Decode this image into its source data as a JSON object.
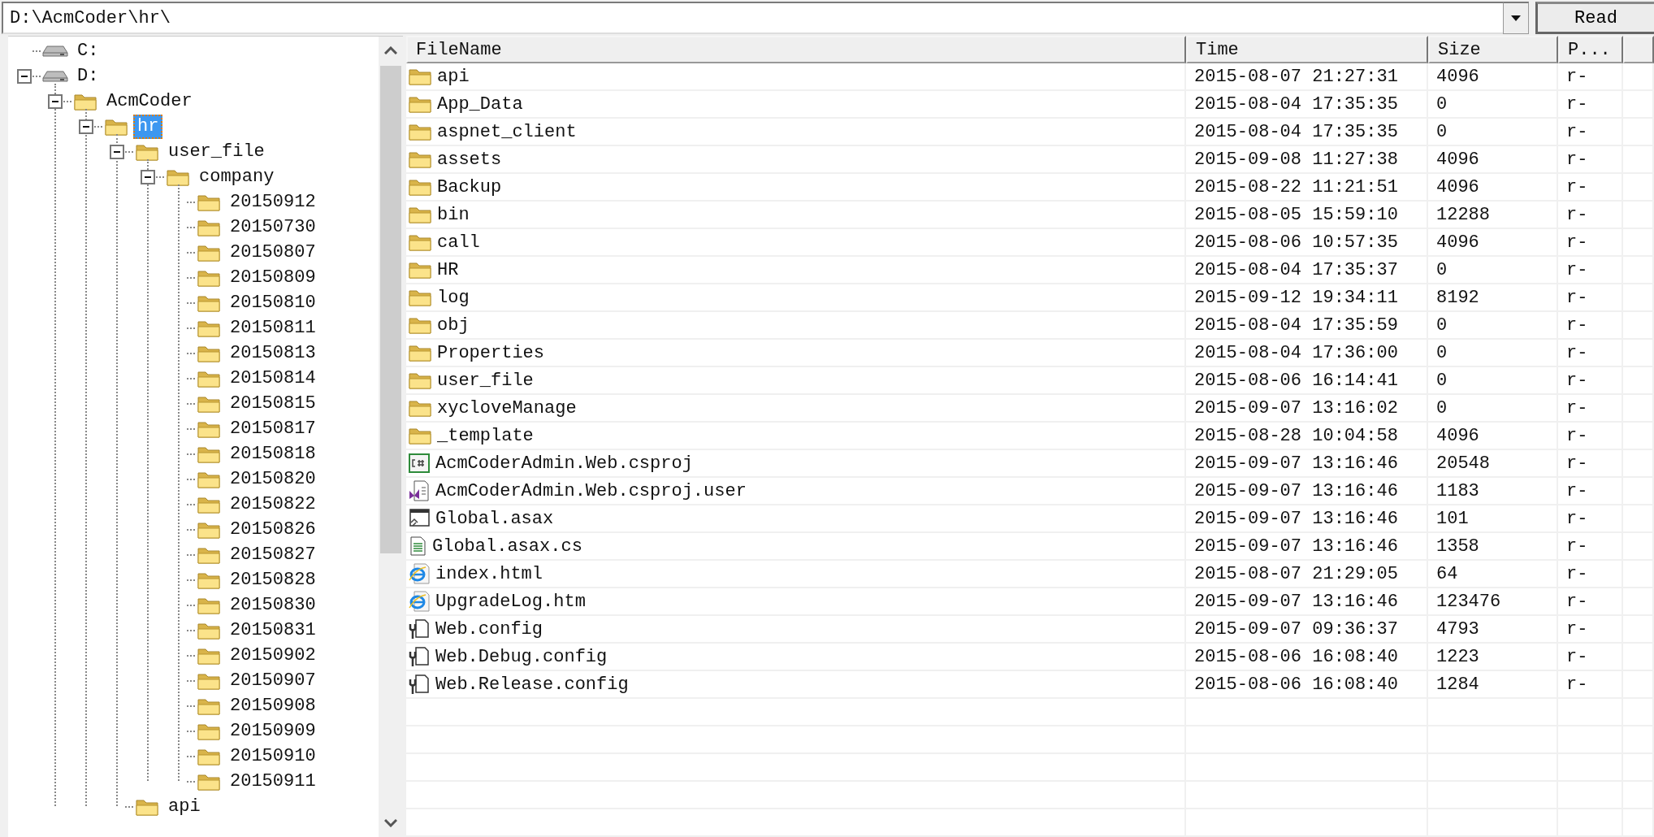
{
  "path_field": {
    "value": "D:\\AcmCoder\\hr\\"
  },
  "read_button": "Read",
  "tree": [
    {
      "label": "C:",
      "kind": "drive",
      "selected": false
    },
    {
      "label": "D:",
      "kind": "drive",
      "selected": false,
      "expanded": true,
      "children": [
        {
          "label": "AcmCoder",
          "kind": "folder",
          "selected": false,
          "expanded": true,
          "children": [
            {
              "label": "hr",
              "kind": "folder",
              "selected": true,
              "expanded": true,
              "children": [
                {
                  "label": "user_file",
                  "kind": "folder",
                  "selected": false,
                  "expanded": true,
                  "children": [
                    {
                      "label": "company",
                      "kind": "folder",
                      "selected": false,
                      "expanded": true,
                      "children": [
                        {
                          "label": "20150912",
                          "kind": "folder",
                          "selected": false
                        },
                        {
                          "label": "20150730",
                          "kind": "folder",
                          "selected": false
                        },
                        {
                          "label": "20150807",
                          "kind": "folder",
                          "selected": false
                        },
                        {
                          "label": "20150809",
                          "kind": "folder",
                          "selected": false
                        },
                        {
                          "label": "20150810",
                          "kind": "folder",
                          "selected": false
                        },
                        {
                          "label": "20150811",
                          "kind": "folder",
                          "selected": false
                        },
                        {
                          "label": "20150813",
                          "kind": "folder",
                          "selected": false
                        },
                        {
                          "label": "20150814",
                          "kind": "folder",
                          "selected": false
                        },
                        {
                          "label": "20150815",
                          "kind": "folder",
                          "selected": false
                        },
                        {
                          "label": "20150817",
                          "kind": "folder",
                          "selected": false
                        },
                        {
                          "label": "20150818",
                          "kind": "folder",
                          "selected": false
                        },
                        {
                          "label": "20150820",
                          "kind": "folder",
                          "selected": false
                        },
                        {
                          "label": "20150822",
                          "kind": "folder",
                          "selected": false
                        },
                        {
                          "label": "20150826",
                          "kind": "folder",
                          "selected": false
                        },
                        {
                          "label": "20150827",
                          "kind": "folder",
                          "selected": false
                        },
                        {
                          "label": "20150828",
                          "kind": "folder",
                          "selected": false
                        },
                        {
                          "label": "20150830",
                          "kind": "folder",
                          "selected": false
                        },
                        {
                          "label": "20150831",
                          "kind": "folder",
                          "selected": false
                        },
                        {
                          "label": "20150902",
                          "kind": "folder",
                          "selected": false
                        },
                        {
                          "label": "20150907",
                          "kind": "folder",
                          "selected": false
                        },
                        {
                          "label": "20150908",
                          "kind": "folder",
                          "selected": false
                        },
                        {
                          "label": "20150909",
                          "kind": "folder",
                          "selected": false
                        },
                        {
                          "label": "20150910",
                          "kind": "folder",
                          "selected": false
                        },
                        {
                          "label": "20150911",
                          "kind": "folder",
                          "selected": false
                        }
                      ]
                    }
                  ]
                },
                {
                  "label": "api",
                  "kind": "folder",
                  "selected": false
                }
              ]
            }
          ]
        }
      ]
    }
  ],
  "file_list": {
    "columns": [
      "FileName",
      "Time",
      "Size",
      "P..."
    ],
    "rows": [
      {
        "kind": "folder",
        "name": "api",
        "time": "2015-08-07 21:27:31",
        "size": "4096",
        "permission": "r-"
      },
      {
        "kind": "folder",
        "name": "App_Data",
        "time": "2015-08-04 17:35:35",
        "size": "0",
        "permission": "r-"
      },
      {
        "kind": "folder",
        "name": "aspnet_client",
        "time": "2015-08-04 17:35:35",
        "size": "0",
        "permission": "r-"
      },
      {
        "kind": "folder",
        "name": "assets",
        "time": "2015-09-08 11:27:38",
        "size": "4096",
        "permission": "r-"
      },
      {
        "kind": "folder",
        "name": "Backup",
        "time": "2015-08-22 11:21:51",
        "size": "4096",
        "permission": "r-"
      },
      {
        "kind": "folder",
        "name": "bin",
        "time": "2015-08-05 15:59:10",
        "size": "12288",
        "permission": "r-"
      },
      {
        "kind": "folder",
        "name": "call",
        "time": "2015-08-06 10:57:35",
        "size": "4096",
        "permission": "r-"
      },
      {
        "kind": "folder",
        "name": "HR",
        "time": "2015-08-04 17:35:37",
        "size": "0",
        "permission": "r-"
      },
      {
        "kind": "folder",
        "name": "log",
        "time": "2015-09-12 19:34:11",
        "size": "8192",
        "permission": "r-"
      },
      {
        "kind": "folder",
        "name": "obj",
        "time": "2015-08-04 17:35:59",
        "size": "0",
        "permission": "r-"
      },
      {
        "kind": "folder",
        "name": "Properties",
        "time": "2015-08-04 17:36:00",
        "size": "0",
        "permission": "r-"
      },
      {
        "kind": "folder",
        "name": "user_file",
        "time": "2015-08-06 16:14:41",
        "size": "0",
        "permission": "r-"
      },
      {
        "kind": "folder",
        "name": "xycloveManage",
        "time": "2015-09-07 13:16:02",
        "size": "0",
        "permission": "r-"
      },
      {
        "kind": "folder",
        "name": "_template",
        "time": "2015-08-28 10:04:58",
        "size": "4096",
        "permission": "r-"
      },
      {
        "kind": "project",
        "name": "AcmCoderAdmin.Web.csproj",
        "time": "2015-09-07 13:16:46",
        "size": "20548",
        "permission": "r-"
      },
      {
        "kind": "user",
        "name": "AcmCoderAdmin.Web.csproj.user",
        "time": "2015-09-07 13:16:46",
        "size": "1183",
        "permission": "r-"
      },
      {
        "kind": "asax",
        "name": "Global.asax",
        "time": "2015-09-07 13:16:46",
        "size": "101",
        "permission": "r-"
      },
      {
        "kind": "code",
        "name": "Global.asax.cs",
        "time": "2015-09-07 13:16:46",
        "size": "1358",
        "permission": "r-"
      },
      {
        "kind": "webpage",
        "name": "index.html",
        "time": "2015-08-07 21:29:05",
        "size": "64",
        "permission": "r-"
      },
      {
        "kind": "webpage",
        "name": "UpgradeLog.htm",
        "time": "2015-09-07 13:16:46",
        "size": "123476",
        "permission": "r-"
      },
      {
        "kind": "config",
        "name": "Web.config",
        "time": "2015-09-07 09:36:37",
        "size": "4793",
        "permission": "r-"
      },
      {
        "kind": "config",
        "name": "Web.Debug.config",
        "time": "2015-08-06 16:08:40",
        "size": "1223",
        "permission": "r-"
      },
      {
        "kind": "config",
        "name": "Web.Release.config",
        "time": "2015-08-06 16:08:40",
        "size": "1284",
        "permission": "r-"
      }
    ]
  }
}
